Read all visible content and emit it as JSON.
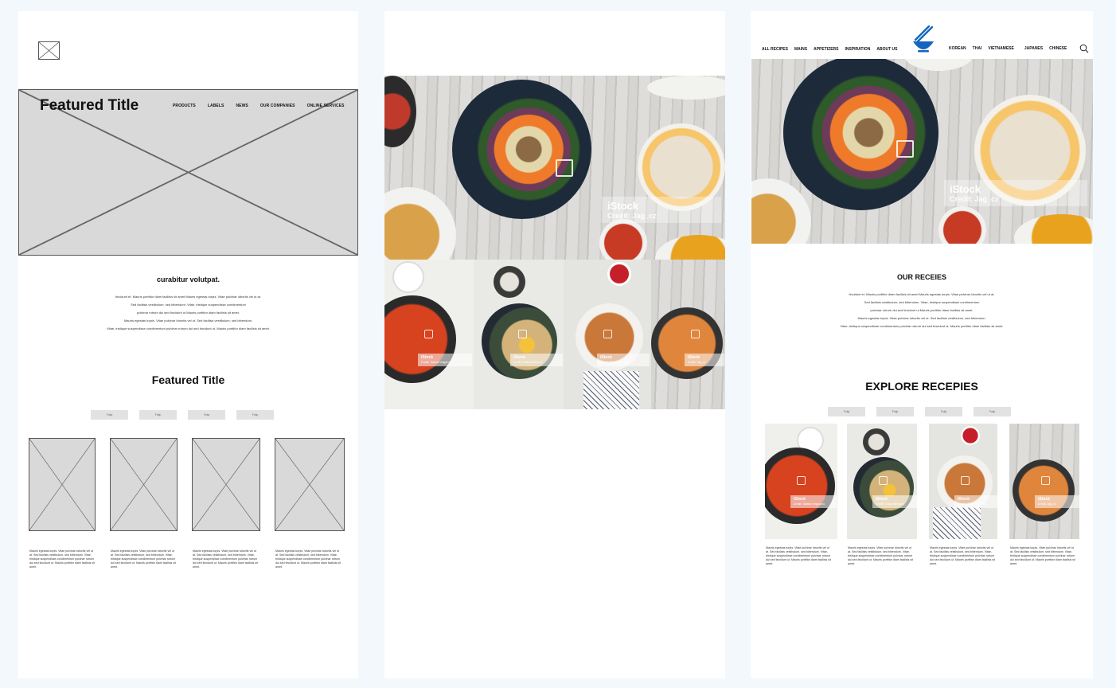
{
  "wireframe": {
    "hero_title": "Featured Title",
    "nav": [
      "PRODUCTS",
      "LABELS",
      "NEWS",
      "OUR COMPANIES",
      "ONLINE SERVICES"
    ],
    "intro_title": "curabitur volutpat.",
    "intro_lines": [
      "tincidunt et. Mauris porttitor diam facilisis sit amet Mauris egestas turpis. Vitae pulvinar lobortis vel ut at.",
      "Sed facilisis vestibulum, sed bibendum. Vitae, tristique suspendisse condimentum",
      "pulvinar rutrum dui sed tincidunt ut Mauris porttitor diam facilisis sit amet.",
      "Mauris egestas turpis. Vitae pulvinar lobortis vel ut. Sed facilisis vestibulum, sed bibendum.",
      "Vitae, tristique suspendisse condimentum pulvinar rutrum dui sed tincidunt ut. Mauris porttitor diam facilisis sit amet."
    ],
    "featured_title": "Featured Title",
    "tabs": [
      "Folip",
      "Folip",
      "Folip",
      "Folip"
    ],
    "card_text": [
      "Mauris egestas turpis. Vitae pulvinar lobortis vel ut at. Sed facilisis vestibulum, sed bibendum. Vitae, tristique suspendisse condimentum pulvinar rutrum dui sed tincidunt ut. Mauris porttitor diam facilisis sit amet.",
      "Mauris egestas turpis. Vitae pulvinar lobortis vel ut at. Sed facilisis vestibulum, sed bibendum. Vitae, tristique suspendisse condimentum pulvinar rutrum dui sed tincidunt ut. Mauris porttitor diam facilisis sit amet.",
      "Mauris egestas turpis. Vitae pulvinar lobortis vel ut at. Sed facilisis vestibulum, sed bibendum. Vitae, tristique suspendisse condimentum pulvinar rutrum dui sed tincidunt ut. Mauris porttitor diam facilisis sit amet.",
      "Mauris egestas turpis. Vitae pulvinar lobortis vel ut at. Sed facilisis vestibulum, sed bibendum. Vitae, tristique suspendisse condimentum pulvinar rutrum dui sed tincidunt ut. Mauris porttitor diam facilisis sit amet."
    ]
  },
  "moodboard": {
    "hero_brand": "iStock",
    "hero_credit": "Credit: Jag_cz",
    "thumb_brand": "iStock",
    "thumb_credits": [
      "Credit: Tatiana Volgutova",
      "Credit: Chiara Belcuore",
      "Credit: Diana Yakovleva",
      "Credit: Jag_cz"
    ]
  },
  "design": {
    "nav_left": [
      "ALL RECIPES",
      "MAINS",
      "APPETIZERS",
      "INSPIRATION",
      "ABOUT US"
    ],
    "nav_right": [
      "KOREAN",
      "THAI",
      "VIETNAMESE",
      "JAPANES",
      "CHINESE"
    ],
    "hero_brand": "iStock",
    "hero_credit": "Credit: Jag_cz",
    "our_title": "OUR RECEIES",
    "our_lines": [
      "tincidunt et. Mauris porttitor diam facilisis sit amet Mauris egestas turpis. Vitae pulvinar lobortis vel ut at.",
      "Sed facilisis vestibulum, sed bibendum. Vitae, tristique suspendisse condimentum",
      "pulvinar rutrum dui sed tincidunt ut Mauris porttitor diam facilisis sit amet.",
      "Mauris egestas turpis. Vitae pulvinar lobortis vel ut. Sed facilisis vestibulum, sed bibendum.",
      "Vitae, tristique suspendisse condimentum pulvinar rutrum dui sed tincidunt ut. Mauris porttitor diam facilisis sit amet."
    ],
    "explore_title": "EXPLORE RECEPIES",
    "tabs": [
      "Folip",
      "Folip",
      "Folip",
      "Folip"
    ],
    "thumb_brand": "iStock",
    "thumb_credits": [
      "Credit: Tatiana Volgutova",
      "Credit: Chiara Belcuore",
      "Credit: Diana Yakovleva",
      "Credit: Jag_cz"
    ],
    "card_text": [
      "Mauris egestas turpis. Vitae pulvinar lobortis vel ut at. Sed facilisis vestibulum, sed bibendum. Vitae, tristique suspendisse condimentum pulvinar rutrum dui sed tincidunt ut. Mauris porttitor diam facilisis sit amet.",
      "Mauris egestas turpis. Vitae pulvinar lobortis vel ut at. Sed facilisis vestibulum, sed bibendum. Vitae, tristique suspendisse condimentum pulvinar rutrum dui sed tincidunt ut. Mauris porttitor diam facilisis sit amet.",
      "Mauris egestas turpis. Vitae pulvinar lobortis vel ut at. Sed facilisis vestibulum, sed bibendum. Vitae, tristique suspendisse condimentum pulvinar rutrum dui sed tincidunt ut. Mauris porttitor diam facilisis sit amet.",
      "Mauris egestas turpis. Vitae pulvinar lobortis vel ut at. Sed facilisis vestibulum, sed bibendum. Vitae, tristique suspendisse condimentum pulvinar rutrum dui sed tincidunt ut. Mauris porttitor diam facilisis sit amet."
    ]
  },
  "colors": {
    "canvas": "#f3f8fd",
    "placeholder": "#d9d9d9",
    "logo_blue": "#1565c0"
  }
}
